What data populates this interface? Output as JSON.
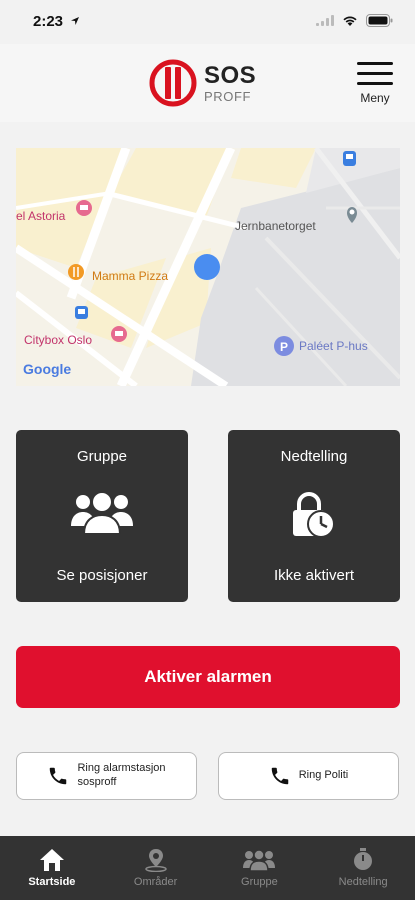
{
  "status_bar": {
    "time": "2:23"
  },
  "header": {
    "logo_title": "SOS",
    "logo_subtitle": "PROFF",
    "menu_label": "Meny"
  },
  "map": {
    "places": {
      "astoria": "el Astoria",
      "mamma_pizza": "Mamma Pizza",
      "citybox": "Citybox Oslo",
      "jernbanetorget": "Jernbanetorget",
      "paleet": "Paléet P-hus",
      "provider": "Google"
    },
    "colors": {
      "user_dot": "#4a8df0",
      "hotel_pin": "#e66a8f",
      "food_pin": "#f29a25",
      "parking_pin": "#7c8ce0"
    }
  },
  "cards": {
    "group": {
      "title": "Gruppe",
      "subtitle": "Se posisjoner",
      "icon": "group-icon"
    },
    "countdown": {
      "title": "Nedtelling",
      "subtitle": "Ikke aktivert",
      "icon": "lock-clock-icon"
    }
  },
  "alarm": {
    "label": "Aktiver alarmen",
    "color": "#e0102e"
  },
  "calls": {
    "station": {
      "label_line1": "Ring alarmstasjon",
      "label_line2": "sosproff",
      "icon": "phone-icon"
    },
    "police": {
      "label": "Ring Politi",
      "icon": "phone-icon"
    }
  },
  "tabs": [
    {
      "label": "Startside",
      "icon": "home-icon",
      "active": true
    },
    {
      "label": "Områder",
      "icon": "location-pin-icon",
      "active": false
    },
    {
      "label": "Gruppe",
      "icon": "group-icon",
      "active": false
    },
    {
      "label": "Nedtelling",
      "icon": "stopwatch-icon",
      "active": false
    }
  ]
}
